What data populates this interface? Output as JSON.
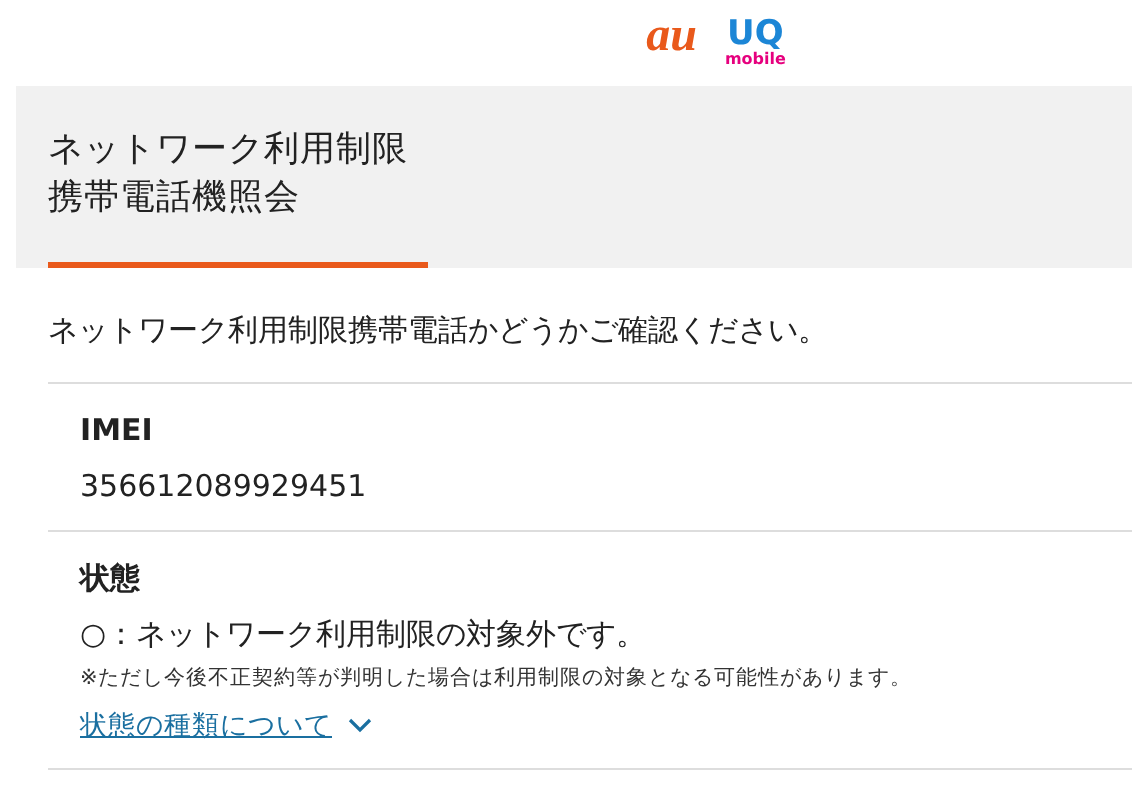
{
  "logos": [
    "au",
    "UQ",
    "mobile"
  ],
  "title_lines": [
    "ネットワーク利用制限",
    "携帯電話機照会"
  ],
  "intro": "ネットワーク利用制限携帯電話かどうかご確認ください。",
  "imei": {
    "label": "IMEI",
    "value": "356612089929451"
  },
  "status": {
    "label": "状態",
    "value": "○：ネットワーク利用制限の対象外です。",
    "note": "※ただし今後不正契約等が判明した場合は利用制限の対象となる可能性があります。",
    "link": "状態の種類について",
    "expanded": false
  }
}
